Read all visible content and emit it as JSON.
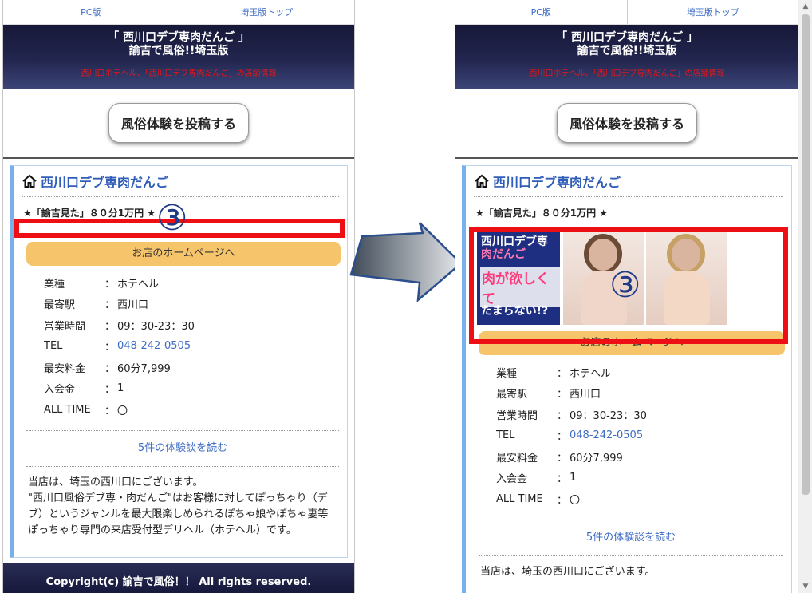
{
  "nav": {
    "pc_label": "PC版",
    "top_label": "埼玉版トップ"
  },
  "header": {
    "title": "「 西川口デブ専肉だんご 」",
    "subtitle": "諭吉で風俗!!埼玉版",
    "desc": "西川口ホテヘル、「西川口デブ専肉だんご」の店舗情報"
  },
  "post_button": "風俗体験を投稿する",
  "shop": {
    "name": "西川口デブ専肉だんご",
    "catch": "★「諭吉見た」８０分1万円 ★",
    "homepage_button": "お店のホームページへ",
    "info": [
      {
        "key": "業種",
        "value": "ホテヘル"
      },
      {
        "key": "最寄駅",
        "value": "西川口"
      },
      {
        "key": "営業時間",
        "value": "09：30-23：30"
      },
      {
        "key": "TEL",
        "value": "048-242-0505"
      },
      {
        "key": "最安料金",
        "value": "60分7,999"
      },
      {
        "key": "入会金",
        "value": "1"
      },
      {
        "key": "ALL TIME",
        "value": "〇"
      }
    ],
    "review_link": "5件の体験談を読む",
    "desc_left": "当店は、埼玉の西川口にございます。\n\"西川口風俗デブ専・肉だんご\"はお客様に対してぽっちゃり（デブ）というジャンルを最大限楽しめられるぽちゃ娘やぽちゃ妻等ぽっちゃり専門の来店受付型デリヘル（ホテヘル）です。",
    "desc_right": "当店は、埼玉の西川口にございます。",
    "banner": {
      "line1": "西川口デブ専",
      "line2": "肉だんご",
      "line3": "肉が欲しくて",
      "line4": "たまらない!?"
    }
  },
  "footer": "Copyright(c) 諭吉で風俗！！ All rights reserved.",
  "annotation": {
    "marker": "③",
    "color": "#ee0f14"
  },
  "colors": {
    "link": "#3d6cc4",
    "header_bg": "#1f2146",
    "button": "#f6c46a",
    "card_border": "#7ab0ea"
  }
}
